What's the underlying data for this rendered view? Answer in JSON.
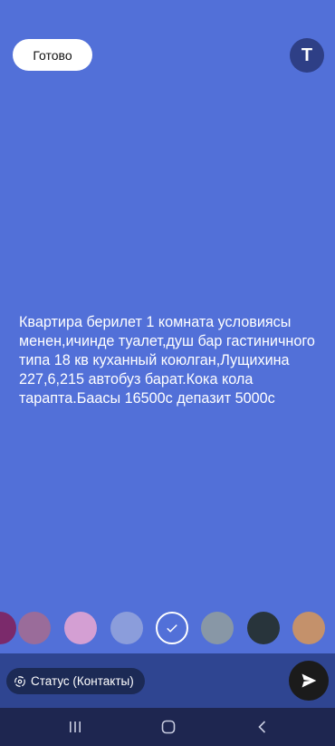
{
  "header": {
    "done_label": "Готово",
    "text_style_label": "T"
  },
  "status": {
    "text": "Квартира берилет 1 комната условиясы менен,ичинде туалет,душ бар гастиничного типа 18 кв куханный коюлган,Лущихина  227,6,215 автобуз барат.Кока кола тарапта.Баасы 16500с депазит 5000с"
  },
  "palette": {
    "colors": [
      "#7b2a6b",
      "#9a6c9a",
      "#d49fd3",
      "#8b9ddb",
      "#5270d8",
      "#8897a6",
      "#28343b",
      "#c4916b"
    ],
    "selected_index": 4
  },
  "audience": {
    "label": "Статус (Контакты)"
  },
  "colors": {
    "background": "#5270d8"
  }
}
